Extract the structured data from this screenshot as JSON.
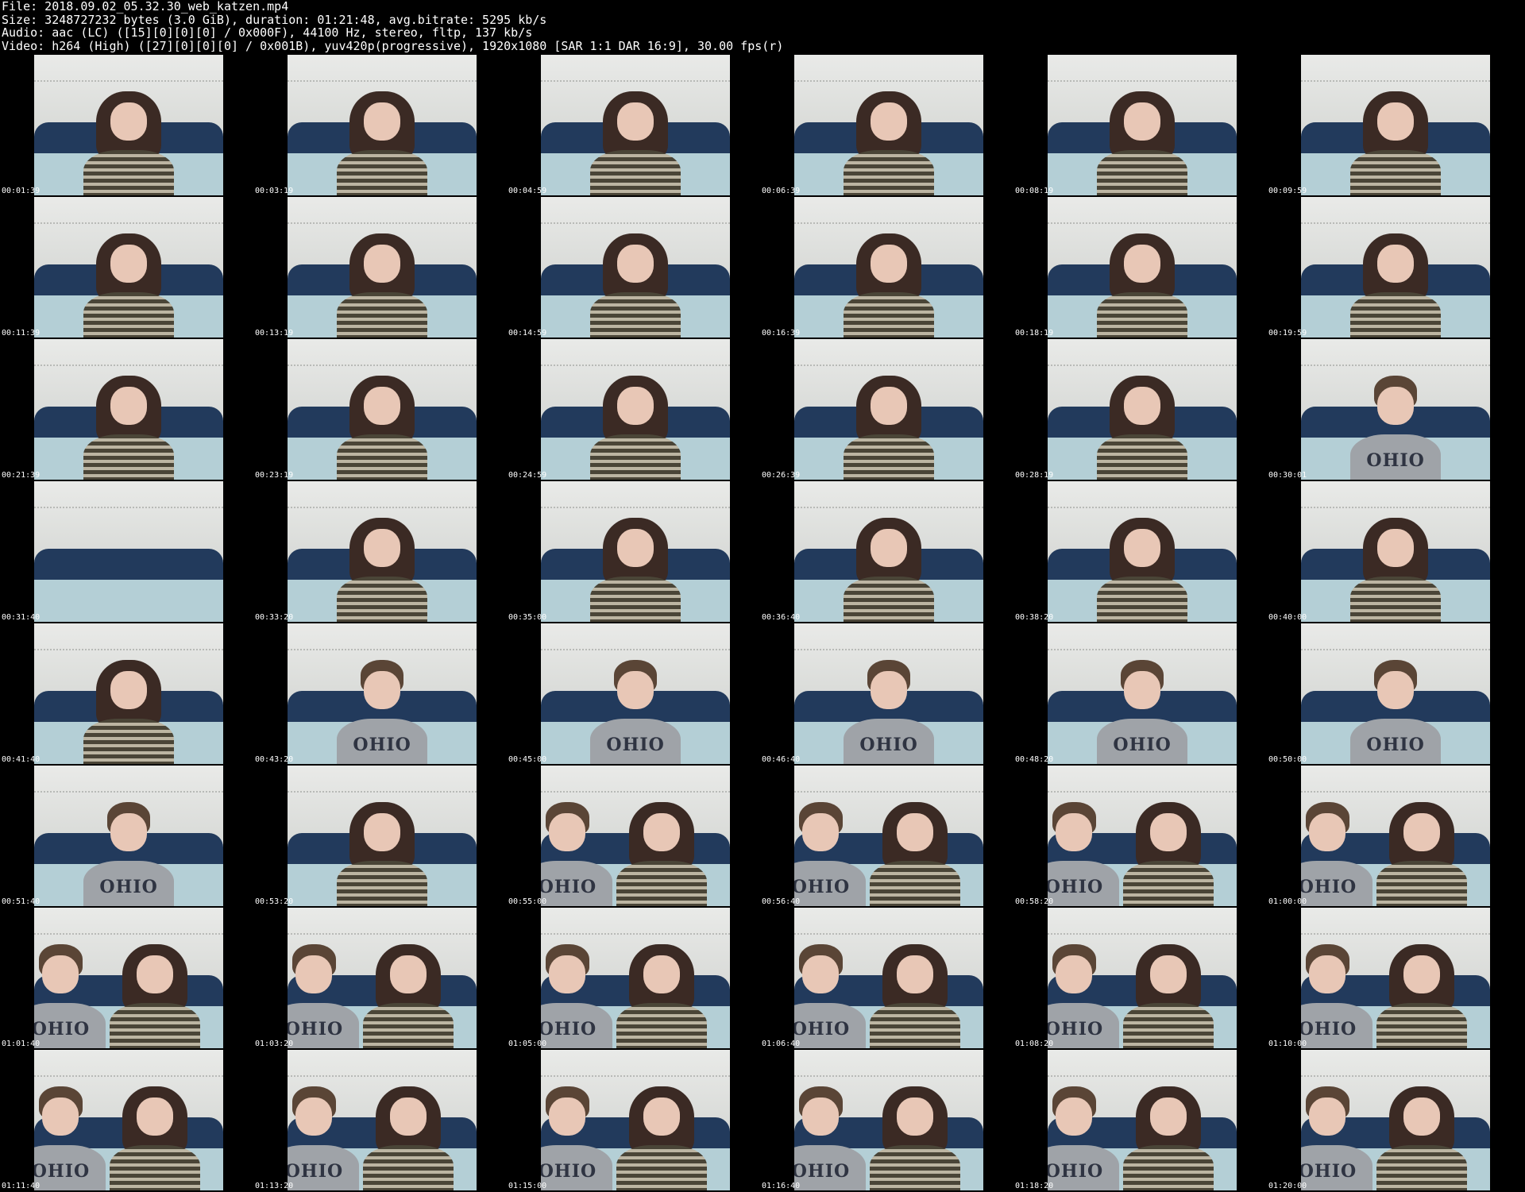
{
  "header": {
    "file": "File: 2018.09.02_05.32.30_web_katzen.mp4",
    "size": "Size: 3248727232 bytes (3.0 GiB), duration: 01:21:48, avg.bitrate: 5295 kb/s",
    "audio": "Audio: aac (LC) ([15][0][0][0] / 0x000F), 44100 Hz, stereo, fltp, 137 kb/s",
    "video": "Video: h264 (High) ([27][0][0][0] / 0x001B), yuv420p(progressive), 1920x1080 [SAR 1:1 DAR 16:9], 30.00 fps(r)"
  },
  "thumbnails": [
    {
      "time": "00:01:39",
      "scene": "woman"
    },
    {
      "time": "00:03:19",
      "scene": "woman"
    },
    {
      "time": "00:04:59",
      "scene": "woman"
    },
    {
      "time": "00:06:39",
      "scene": "woman"
    },
    {
      "time": "00:08:19",
      "scene": "woman"
    },
    {
      "time": "00:09:59",
      "scene": "woman"
    },
    {
      "time": "00:11:39",
      "scene": "woman"
    },
    {
      "time": "00:13:19",
      "scene": "woman"
    },
    {
      "time": "00:14:59",
      "scene": "woman"
    },
    {
      "time": "00:16:39",
      "scene": "woman"
    },
    {
      "time": "00:18:19",
      "scene": "woman"
    },
    {
      "time": "00:19:59",
      "scene": "woman"
    },
    {
      "time": "00:21:39",
      "scene": "woman"
    },
    {
      "time": "00:23:19",
      "scene": "woman"
    },
    {
      "time": "00:24:59",
      "scene": "woman"
    },
    {
      "time": "00:26:39",
      "scene": "woman"
    },
    {
      "time": "00:28:19",
      "scene": "woman"
    },
    {
      "time": "00:30:01",
      "scene": "man"
    },
    {
      "time": "00:31:40",
      "scene": "empty"
    },
    {
      "time": "00:33:20",
      "scene": "woman"
    },
    {
      "time": "00:35:00",
      "scene": "woman"
    },
    {
      "time": "00:36:40",
      "scene": "woman"
    },
    {
      "time": "00:38:20",
      "scene": "woman"
    },
    {
      "time": "00:40:00",
      "scene": "woman"
    },
    {
      "time": "00:41:40",
      "scene": "woman"
    },
    {
      "time": "00:43:20",
      "scene": "man"
    },
    {
      "time": "00:45:00",
      "scene": "man"
    },
    {
      "time": "00:46:40",
      "scene": "man"
    },
    {
      "time": "00:48:20",
      "scene": "man"
    },
    {
      "time": "00:50:00",
      "scene": "man"
    },
    {
      "time": "00:51:40",
      "scene": "man"
    },
    {
      "time": "00:53:20",
      "scene": "woman"
    },
    {
      "time": "00:55:00",
      "scene": "couple"
    },
    {
      "time": "00:56:40",
      "scene": "couple"
    },
    {
      "time": "00:58:20",
      "scene": "couple"
    },
    {
      "time": "01:00:00",
      "scene": "couple"
    },
    {
      "time": "01:01:40",
      "scene": "couple"
    },
    {
      "time": "01:03:20",
      "scene": "couple"
    },
    {
      "time": "01:05:00",
      "scene": "couple"
    },
    {
      "time": "01:06:40",
      "scene": "couple"
    },
    {
      "time": "01:08:20",
      "scene": "couple"
    },
    {
      "time": "01:10:00",
      "scene": "couple"
    },
    {
      "time": "01:11:40",
      "scene": "couple"
    },
    {
      "time": "01:13:20",
      "scene": "couple"
    },
    {
      "time": "01:15:00",
      "scene": "couple"
    },
    {
      "time": "01:16:40",
      "scene": "couple"
    },
    {
      "time": "01:18:20",
      "scene": "couple"
    },
    {
      "time": "01:20:00",
      "scene": "couple"
    }
  ]
}
